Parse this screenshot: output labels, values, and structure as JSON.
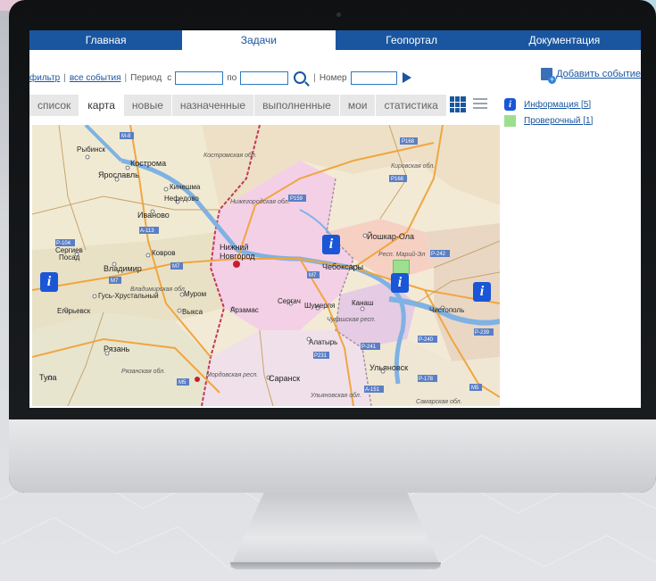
{
  "nav": {
    "tabs": [
      "Главная",
      "Задачи",
      "Геопортал",
      "Документация"
    ],
    "active": 1
  },
  "filter": {
    "filter_link": "фильтр",
    "all_events_link": "все события",
    "period_label": "Период",
    "from_label": "с",
    "to_label": "по",
    "number_label": "Номер",
    "from_value": "",
    "to_value": "",
    "number_value": "",
    "add_event": "Добавить событие"
  },
  "subtabs": {
    "items": [
      "список",
      "карта",
      "новые",
      "назначенные",
      "выполненные",
      "мои",
      "статистика"
    ],
    "active": 1
  },
  "legend": {
    "items": [
      {
        "label": "Информация [5]",
        "color": "#1a56d6",
        "icon": "info-icon"
      },
      {
        "label": "Проверочный [1]",
        "color": "#9ce08f",
        "icon": "square-icon"
      }
    ]
  },
  "map": {
    "cities": [
      "Рыбинск",
      "Кострома",
      "Ярославль",
      "Кинешма",
      "Нефедово",
      "Иваново",
      "Нижний",
      "Новгород",
      "Сергиев",
      "Посад",
      "Владимир",
      "Ковров",
      "Йошкар-Ола",
      "Респ. Марий-Эл",
      "Чебоксары",
      "Муром",
      "Гусь-Хрустальный",
      "Егорьевск",
      "Выкса",
      "Арзамас",
      "Сергач",
      "Шумерля",
      "Канаш",
      "Чистополь",
      "Алатырь",
      "Рязань",
      "Тула",
      "Саранск",
      "Ульяновск",
      "Мордовская респ.",
      "Ульяновская обл.",
      "Самарская обл.",
      "Костромская обл.",
      "Кировская обл.",
      "Нижегородская обл.",
      "Владимирская обл.",
      "Рязанская обл.",
      "Чувашская респ."
    ],
    "roads": [
      "M-8",
      "P168",
      "P159",
      "A-113",
      "P-104",
      "M7",
      "P-242",
      "P-241",
      "P-240",
      "P-239",
      "P231",
      "P-178",
      "A-151",
      "M5"
    ],
    "markers": [
      "info-marker-1",
      "info-marker-2",
      "info-marker-3",
      "info-marker-4",
      "check-marker-1"
    ]
  }
}
